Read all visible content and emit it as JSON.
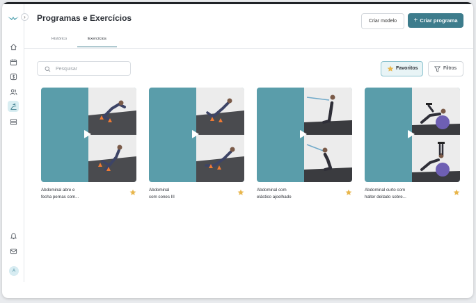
{
  "page": {
    "title": "Programas e Exercícios"
  },
  "header": {
    "create_template_label": "Criar modelo",
    "create_program_label": "Criar programa"
  },
  "tabs": [
    {
      "label": "Histórico"
    },
    {
      "label": "Exercícios",
      "active": true
    }
  ],
  "toolbar": {
    "search_placeholder": "Pesquisar",
    "favorites_label": "Favoritos",
    "filters_label": "Filtros"
  },
  "sidebar": {
    "items": [
      {
        "icon": "home-icon"
      },
      {
        "icon": "calendar-icon"
      },
      {
        "icon": "dollar-icon"
      },
      {
        "icon": "users-icon"
      },
      {
        "icon": "exercise-icon",
        "active": true
      },
      {
        "icon": "layers-icon"
      }
    ],
    "bottom": [
      {
        "icon": "bell-icon"
      },
      {
        "icon": "mail-icon"
      }
    ],
    "avatar_initial": "A",
    "collapse_glyph": "›"
  },
  "colors": {
    "accent": "#3d7c8c",
    "thumb_bg": "#5a9daa",
    "star": "#e8b64c",
    "fav_bg": "#e8f4f6"
  },
  "exercises": [
    {
      "title_line1": "Abdominal abre e",
      "title_line2": "fecha pernas com...",
      "favorite": true
    },
    {
      "title_line1": "Abdominal",
      "title_line2": "com cones III",
      "favorite": true
    },
    {
      "title_line1": "Abdominal com",
      "title_line2": "elástico ajoelhado",
      "favorite": true
    },
    {
      "title_line1": "Abdominal curto com",
      "title_line2": "halter deitado sobre...",
      "favorite": true
    }
  ]
}
